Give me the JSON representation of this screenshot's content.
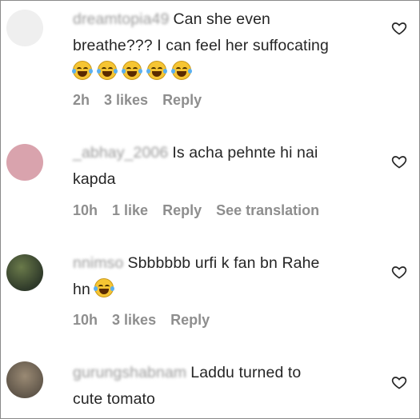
{
  "comments": [
    {
      "username": "dreamtopia49",
      "text_line1": "Can she even",
      "text_line2": "breathe??? I can feel her suffocating",
      "emoji_count": 5,
      "time": "2h",
      "likes": "3 likes",
      "reply": "Reply",
      "avatar_color": "#efefef"
    },
    {
      "username": "_abhay_2006",
      "text_line1": "Is acha pehnte hi nai",
      "text_line2": "kapda",
      "time": "10h",
      "likes": "1 like",
      "reply": "Reply",
      "see_translation": "See translation",
      "avatar_color": "#d9a3ad"
    },
    {
      "username": "nnimso",
      "text_line1": "Sbbbbbb urfi k fan bn Rahe",
      "text_line2": "hn",
      "emoji_count": 1,
      "time": "10h",
      "likes": "3 likes",
      "reply": "Reply",
      "avatar_color": "#4d5a3a"
    },
    {
      "username": "gurungshabnam",
      "text_line1": "Laddu turned to",
      "text_line2": "cute tomato",
      "avatar_color": "#8a7a66"
    }
  ],
  "icons": {
    "like": "heart-outline-icon",
    "emoji": "face-with-tears-of-joy-icon"
  }
}
